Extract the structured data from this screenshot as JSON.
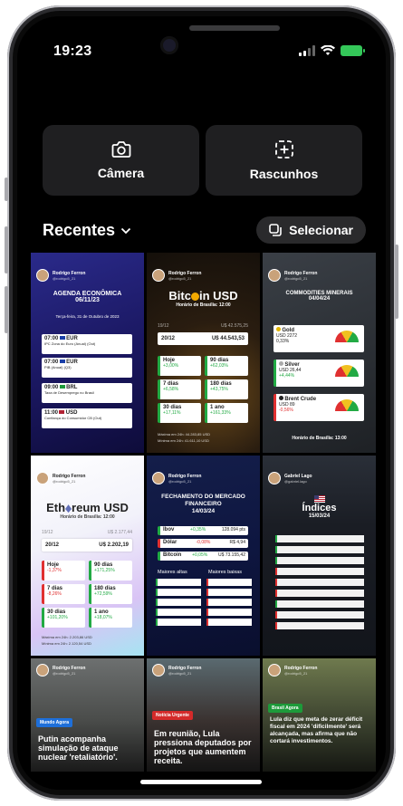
{
  "status": {
    "time": "19:23"
  },
  "tiles": [
    {
      "label": "Câmera",
      "icon": "camera-icon"
    },
    {
      "label": "Rascunhos",
      "icon": "drafts-icon"
    }
  ],
  "section": {
    "title": "Recentes",
    "select_label": "Selecionar"
  },
  "author": {
    "name": "Rodrigo Ferron",
    "handle": "@rodrigo5_21",
    "alt_name": "Gabriel Lago",
    "alt_handle": "@gabriel.lago"
  },
  "post1": {
    "title": "AGENDA ECONÔMICA",
    "date": "06/11/23",
    "subtitle": "Terça-feira, 31 de Outubro de 2023",
    "items": [
      {
        "time": "07:00",
        "cur": "EUR",
        "desc": "IPC Zona do Euro (Anual) (Out)"
      },
      {
        "time": "07:00",
        "cur": "EUR",
        "desc": "PIB (Anual) (Q3)"
      },
      {
        "time": "09:00",
        "cur": "BRL",
        "desc": "Taxa de Desemprego no Brasil"
      },
      {
        "time": "11:00",
        "cur": "USD",
        "desc": "Confiança do Consumidor CB (Out)"
      }
    ]
  },
  "post2": {
    "title_a": "Bitc",
    "title_b": "in USD",
    "sub": "Horário de Brasília: 12:00",
    "prev_date": "19/12",
    "prev_val": "U$ 42.575,25",
    "date": "20/12",
    "val": "U$ 44.543,53",
    "stats": [
      {
        "label": "Hoje",
        "val": "+3,00%"
      },
      {
        "label": "90 dias",
        "val": "+62,03%"
      },
      {
        "label": "7 dias",
        "val": "+6,58%"
      },
      {
        "label": "180 dias",
        "val": "+43,75%"
      },
      {
        "label": "30 dias",
        "val": "+17,11%"
      },
      {
        "label": "1 ano",
        "val": "+161,33%"
      }
    ],
    "foot1": "Máxima em 24h: 44.283,85 USD",
    "foot2": "Mínima em 24h: 41.611,10 USD"
  },
  "post3": {
    "title": "COMMODITIES MINERAIS",
    "date": "04/04/24",
    "items": [
      {
        "name": "Gold",
        "val": "USD 2272",
        "chg": "0,33%"
      },
      {
        "name": "Silver",
        "val": "USD 26,44",
        "chg": "+4,44%"
      },
      {
        "name": "Brent Crude",
        "val": "USD 89",
        "chg": "-0,56%"
      }
    ],
    "foot": "Horário de Brasília: 13:00"
  },
  "post4": {
    "title_a": "Eth",
    "title_b": "reum USD",
    "sub": "Horário de Brasília: 12:00",
    "prev_date": "19/12",
    "prev_val": "U$ 2.177,44",
    "date": "20/12",
    "val": "U$ 2.202,19",
    "stats": [
      {
        "label": "Hoje",
        "val": "-1,37%"
      },
      {
        "label": "90 dias",
        "val": "+171,25%"
      },
      {
        "label": "7 dias",
        "val": "-8,26%"
      },
      {
        "label": "180 dias",
        "val": "+72,59%"
      },
      {
        "label": "30 dias",
        "val": "+101,20%"
      },
      {
        "label": "1 ano",
        "val": "+18,07%"
      }
    ],
    "foot1": "Máxima em 24h: 2.203,86 USD",
    "foot2": "Mínima em 24h: 2.120,54 USD"
  },
  "post5": {
    "title": "FECHAMENTO DO MERCADO FINANCEIRO",
    "date": "14/03/24",
    "rows": [
      {
        "name": "Ibov",
        "chg": "+0,35%",
        "val": "128.094 pts"
      },
      {
        "name": "Dólar",
        "chg": "-0,08%",
        "val": "R$ 4,94"
      },
      {
        "name": "Bitcoin",
        "chg": "+0,05%",
        "val": "U$ 73.155,42"
      }
    ],
    "col_a": "Maiores altas",
    "col_b": "Maiores baixas"
  },
  "post6": {
    "title": "Índices",
    "date": "15/03/24"
  },
  "news": [
    {
      "tag": "Mundo Agora",
      "title": "Putin acompanha simulação de ataque nuclear 'retaliatório'."
    },
    {
      "tag": "Notícia Urgente",
      "title": "Em reunião, Lula pressiona deputados por projetos que aumentem receita."
    },
    {
      "tag": "Brasil Agora",
      "title": "Lula diz que meta de zerar déficit fiscal em 2024 'dificilmente' será alcançada, mas afirma que não cortará investimentos."
    }
  ]
}
